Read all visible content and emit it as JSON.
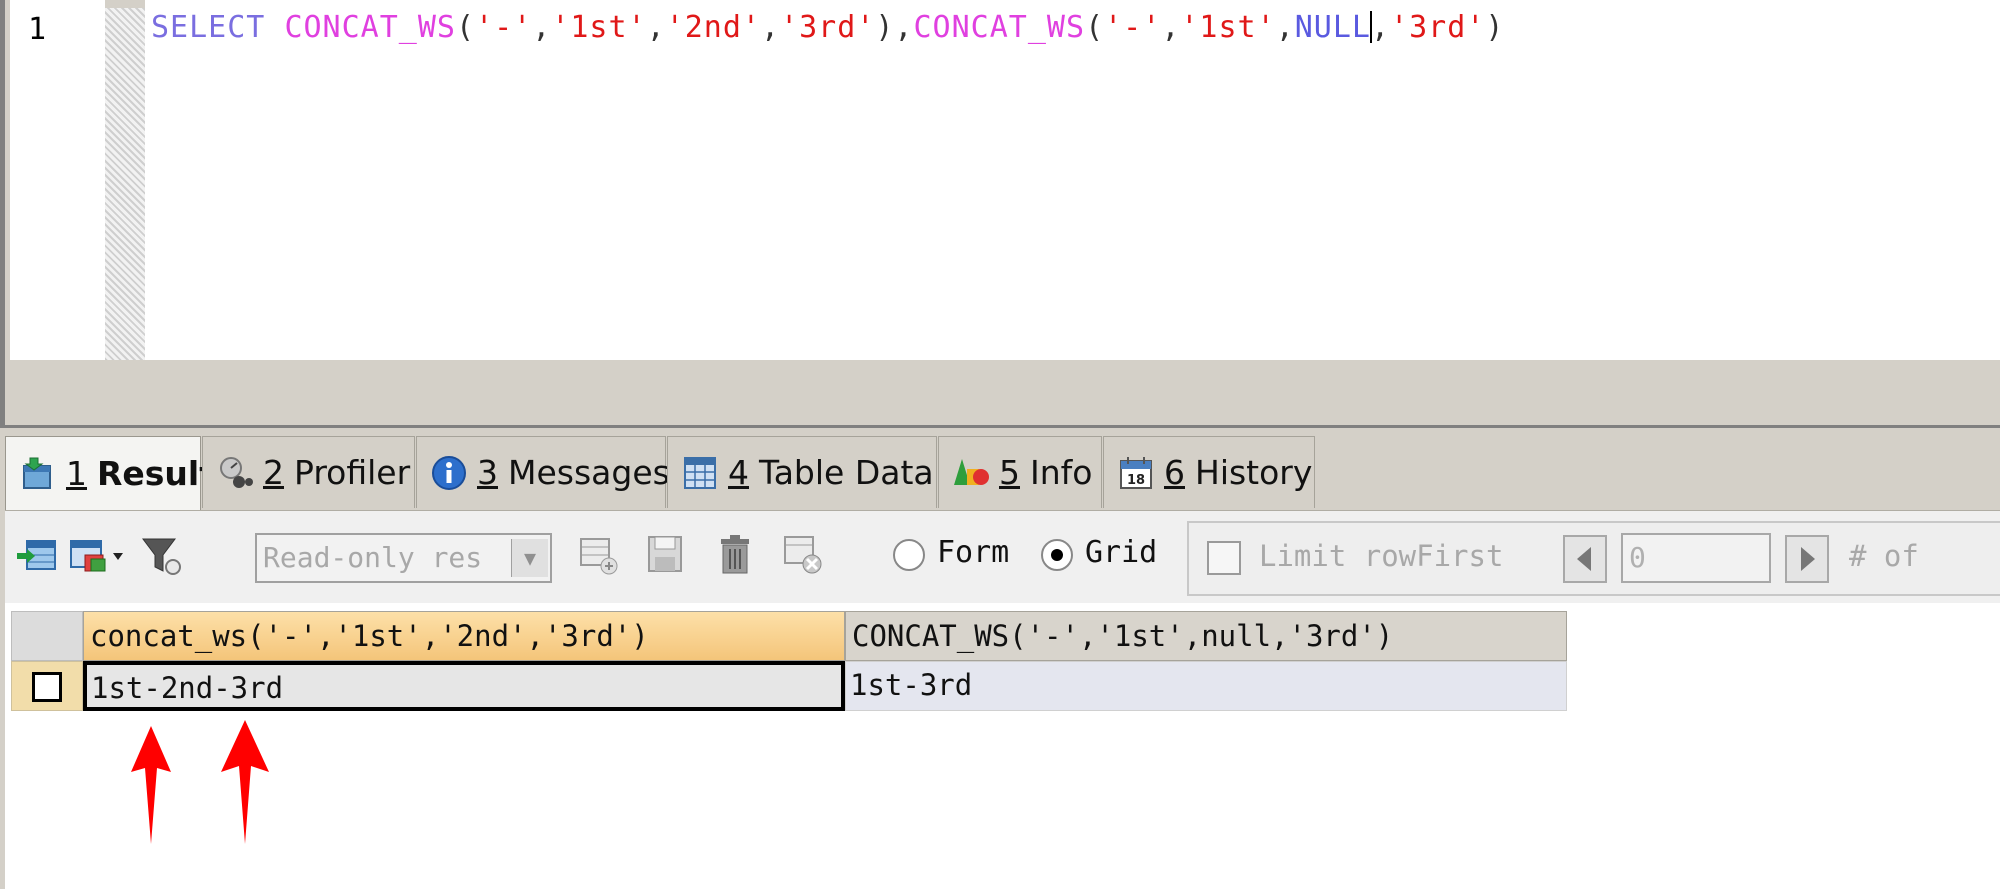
{
  "editor": {
    "line_number": "1",
    "code_tokens": [
      {
        "text": "SELECT",
        "cls": "kw"
      },
      {
        "text": " ",
        "cls": "pn"
      },
      {
        "text": "CONCAT_WS",
        "cls": "fn"
      },
      {
        "text": "(",
        "cls": "pn"
      },
      {
        "text": "'-'",
        "cls": "str"
      },
      {
        "text": ",",
        "cls": "pn"
      },
      {
        "text": "'1st'",
        "cls": "str"
      },
      {
        "text": ",",
        "cls": "pn"
      },
      {
        "text": "'2nd'",
        "cls": "str"
      },
      {
        "text": ",",
        "cls": "pn"
      },
      {
        "text": "'3rd'",
        "cls": "str"
      },
      {
        "text": "),",
        "cls": "pn"
      },
      {
        "text": "CONCAT_WS",
        "cls": "fn"
      },
      {
        "text": "(",
        "cls": "pn"
      },
      {
        "text": "'-'",
        "cls": "str"
      },
      {
        "text": ",",
        "cls": "pn"
      },
      {
        "text": "'1st'",
        "cls": "str"
      },
      {
        "text": ",",
        "cls": "pn"
      },
      {
        "text": "NULL",
        "cls": "nul",
        "caret_after": true
      },
      {
        "text": ",",
        "cls": "pn"
      },
      {
        "text": "'3rd'",
        "cls": "str"
      },
      {
        "text": ")",
        "cls": "pn"
      }
    ]
  },
  "tabs": [
    {
      "num": "1",
      "label": "Result",
      "icon": "result-icon",
      "active": true
    },
    {
      "num": "2",
      "label": "Profiler",
      "icon": "profiler-icon",
      "active": false
    },
    {
      "num": "3",
      "label": "Messages",
      "icon": "info-circle-icon",
      "active": false
    },
    {
      "num": "4",
      "label": "Table Data",
      "icon": "table-icon",
      "active": false
    },
    {
      "num": "5",
      "label": "Info",
      "icon": "shapes-icon",
      "active": false
    },
    {
      "num": "6",
      "label": "History",
      "icon": "calendar-icon",
      "active": false
    }
  ],
  "toolbar": {
    "readonly_select_value": "Read-only res",
    "form_label": "Form",
    "grid_label": "Grid",
    "limit_label": "Limit rowFirst",
    "first_value": "0",
    "of_label": "# of",
    "calendar_day": "18"
  },
  "grid": {
    "columns": [
      "concat_ws('-','1st','2nd','3rd')",
      "CONCAT_WS('-','1st',null,'3rd')"
    ],
    "rows": [
      [
        "1st-2nd-3rd",
        "1st-3rd"
      ]
    ]
  },
  "colors": {
    "keyword": "#7a6ee0",
    "function": "#e040e0",
    "string": "#e01818",
    "null": "#5a5ae0",
    "arrow": "#ff0000"
  }
}
